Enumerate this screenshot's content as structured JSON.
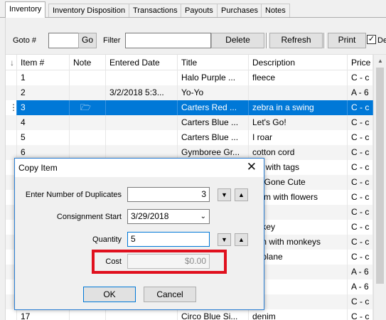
{
  "tabs": [
    "Inventory",
    "Inventory Disposition",
    "Transactions",
    "Payouts",
    "Purchases",
    "Notes"
  ],
  "toolbar": {
    "goto_label": "Goto #",
    "go_button": "Go",
    "filter_label": "Filter",
    "delete_button": "Delete",
    "refresh_button": "Refresh",
    "print_button": "Print",
    "checkbox_label": "De"
  },
  "grid": {
    "columns": [
      "Item #",
      "Note",
      "Entered Date",
      "Title",
      "Description",
      "Price Co"
    ],
    "rows": [
      {
        "item": "1",
        "date": "",
        "title": "Halo Purple ...",
        "desc": "fleece",
        "price": "C - c"
      },
      {
        "item": "2",
        "date": "3/2/2018 5:3...",
        "title": "Yo-Yo",
        "desc": "",
        "price": "A - 6"
      },
      {
        "item": "3",
        "date": "",
        "title": "Carters Red ...",
        "desc": "zebra in a swing",
        "price": "C - c"
      },
      {
        "item": "4",
        "date": "",
        "title": "Carters Blue ...",
        "desc": "Let's Go!",
        "price": "C - c"
      },
      {
        "item": "5",
        "date": "",
        "title": "Carters Blue ...",
        "desc": "I roar",
        "price": "C - c"
      },
      {
        "item": "6",
        "date": "",
        "title": "Gymboree Gr...",
        "desc": "cotton cord",
        "price": "C - c"
      },
      {
        "item": "",
        "date": "",
        "title": "",
        "desc": "ew with tags",
        "price": "C - c"
      },
      {
        "item": "",
        "date": "",
        "title": "",
        "desc": "og Gone Cute",
        "price": "C - c"
      },
      {
        "item": "",
        "date": "",
        "title": "",
        "desc": "enim with flowers",
        "price": "C - c"
      },
      {
        "item": "",
        "date": "",
        "title": "",
        "desc": "",
        "price": "C - c"
      },
      {
        "item": "",
        "date": "",
        "title": "",
        "desc": "onkey",
        "price": "C - c"
      },
      {
        "item": "",
        "date": "",
        "title": "",
        "desc": "een with monkeys",
        "price": "C - c"
      },
      {
        "item": "",
        "date": "",
        "title": "",
        "desc": "airplane",
        "price": "C - c"
      },
      {
        "item": "",
        "date": "",
        "title": "",
        "desc": "",
        "price": "A - 6"
      },
      {
        "item": "",
        "date": "",
        "title": "",
        "desc": "",
        "price": "A - 6"
      },
      {
        "item": "",
        "date": "",
        "title": "",
        "desc": "",
        "price": "C - c"
      },
      {
        "item": "17",
        "date": "",
        "title": "Circo Blue Si...",
        "desc": "denim",
        "price": "C - c"
      }
    ]
  },
  "dialog": {
    "title": "Copy Item",
    "duplicates_label": "Enter Number of Duplicates",
    "duplicates_value": "3",
    "consignment_label": "Consignment Start",
    "consignment_value": "3/29/2018",
    "quantity_label": "Quantity",
    "quantity_value": "5",
    "cost_label": "Cost",
    "cost_value": "$0.00",
    "ok_button": "OK",
    "cancel_button": "Cancel"
  },
  "colors": {
    "selection": "#0078d7",
    "highlight_box": "#e0101e"
  }
}
